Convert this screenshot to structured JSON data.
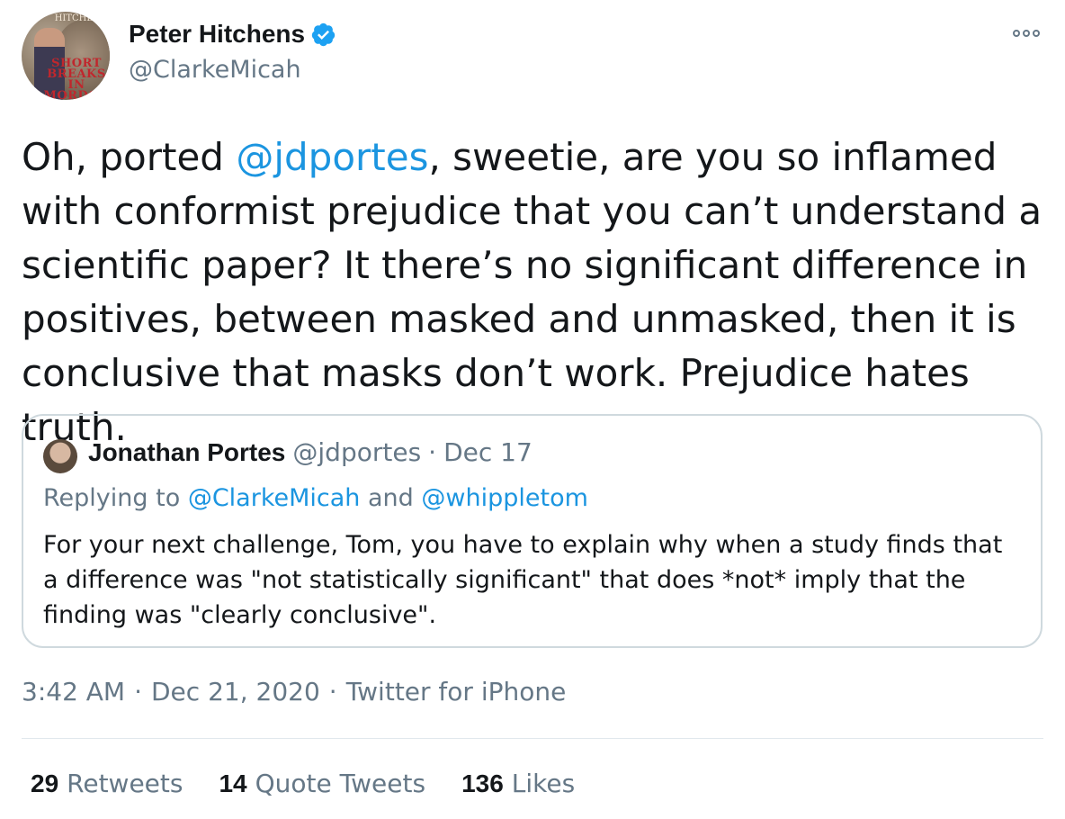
{
  "author": {
    "display_name": "Peter Hitchens",
    "handle": "@ClarkeMicah",
    "verified": true,
    "avatar_text_top": "HITCHENS",
    "avatar_text": "SHORT BREAKS IN MORDOR"
  },
  "tweet": {
    "text_before": "Oh, ported ",
    "mention": "@jdportes",
    "text_after": ", sweetie, are you so inflamed with conformist prejudice that you can’t understand a scientific paper? It there’s no significant difference in positives, between masked and unmasked, then it is conclusive that masks don’t work. Prejudice hates truth."
  },
  "quoted": {
    "display_name": "Jonathan Portes",
    "handle": "@jdportes",
    "separator": "·",
    "date": "Dec 17",
    "replying_label": "Replying to",
    "replying_to_1": "@ClarkeMicah",
    "replying_and": "and",
    "replying_to_2": "@whippletom",
    "text": "For your next challenge, Tom, you have to explain why when a study finds that a difference was \"not statistically significant\" that does *not* imply that the finding was \"clearly conclusive\"."
  },
  "meta": {
    "time": "3:42 AM",
    "sep1": "·",
    "date": "Dec 21, 2020",
    "sep2": "·",
    "source": "Twitter for iPhone"
  },
  "stats": {
    "retweets_count": "29",
    "retweets_label": "Retweets",
    "quotes_count": "14",
    "quotes_label": "Quote Tweets",
    "likes_count": "136",
    "likes_label": "Likes"
  },
  "colors": {
    "link": "#1b95e0",
    "secondary": "#657786",
    "verified": "#1da1f2"
  },
  "icons": {
    "verified": "verified-badge-icon",
    "more": "more-options-icon"
  }
}
